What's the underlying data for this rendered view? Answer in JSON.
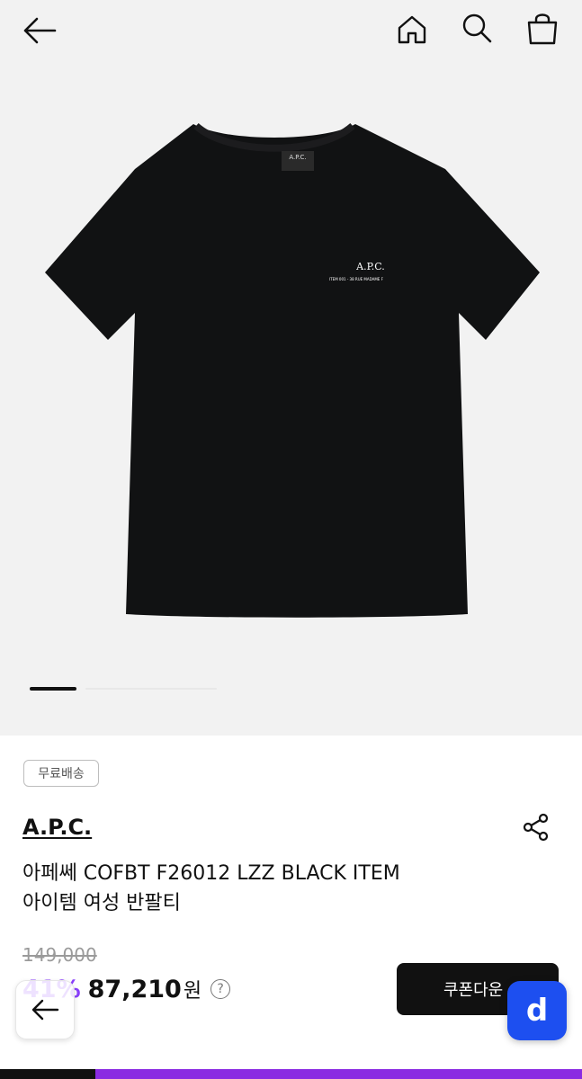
{
  "header": {
    "back_icon": "arrow-left-icon",
    "home_icon": "home-icon",
    "search_icon": "search-icon",
    "bag_icon": "shopping-bag-icon"
  },
  "gallery": {
    "image": "black-tshirt",
    "current_index": 1,
    "shirt_logo": "A.P.C.",
    "shirt_tagline": "ITEM 001 - 38 RUE MADAME F",
    "shirt_label": "A.P.C."
  },
  "product": {
    "shipping_badge": "무료배송",
    "brand": "A.P.C.",
    "title_line1": "아페쎄 COFBT F26012 LZZ BLACK ITEM",
    "title_line2": "아이템 여성 반팔티",
    "original_price": "149,000",
    "discount": "41%",
    "price": "87,210",
    "currency": "원",
    "help_symbol": "?",
    "coupon_button": "쿠폰다운"
  },
  "floating": {
    "back_icon": "arrow-left-icon",
    "app_logo": "d"
  },
  "colors": {
    "accent": "#8a3ffc",
    "app_blue": "#1d4ff0",
    "background_hero": "#f2f2f2"
  }
}
